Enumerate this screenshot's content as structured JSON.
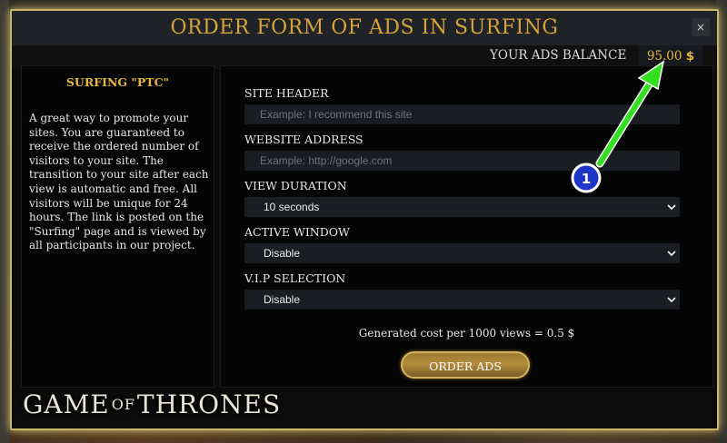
{
  "modal": {
    "title": "ORDER FORM OF ADS IN SURFING",
    "close_label": "×"
  },
  "balance": {
    "label": "YOUR ADS BALANCE",
    "amount": "95.00",
    "currency": "$"
  },
  "info": {
    "title": "SURFING \"PTC\"",
    "description": "A great way to promote your sites. You are guaranteed to receive the ordered number of visitors to your site. The transition to your site after each view is automatic and free. All visitors will be unique for 24 hours. The link is posted on the \"Surfing\" page and is viewed by all participants in our project."
  },
  "form": {
    "site_header_label": "SITE HEADER",
    "site_header_placeholder": "Example: I recommend this site",
    "website_address_label": "WEBSITE ADDRESS",
    "website_address_placeholder": "Example: http://google.com",
    "view_duration_label": "VIEW DURATION",
    "view_duration_value": "10 seconds",
    "active_window_label": "ACTIVE WINDOW",
    "active_window_value": "Disable",
    "vip_selection_label": "V.I.P SELECTION",
    "vip_selection_value": "Disable",
    "cost_text": "Generated cost per 1000 views = 0.5 $",
    "order_button": "ORDER ADS"
  },
  "branding": {
    "logo_left": "GAME",
    "logo_middle": "OF",
    "logo_right": "THRONES"
  },
  "annotation": {
    "marker_number": "1",
    "arrow_color": "#33e01f",
    "marker_color": "#1f36c9"
  },
  "colors": {
    "gold": "#d6a33a",
    "border_glow": "#c8b66b"
  }
}
